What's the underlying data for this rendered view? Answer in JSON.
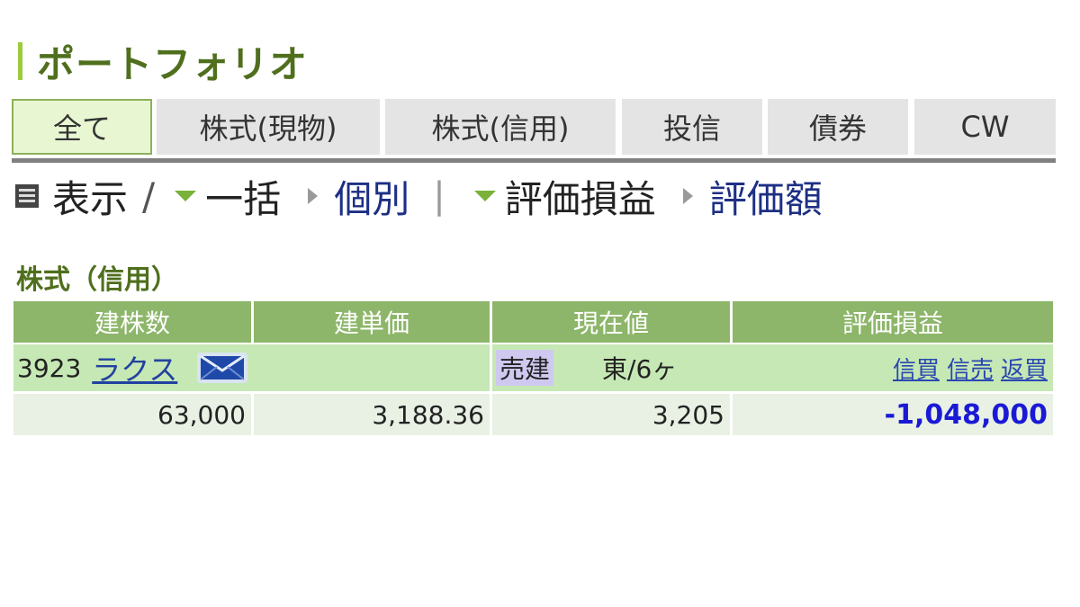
{
  "page": {
    "title": "ポートフォリオ"
  },
  "tabs": [
    {
      "label": "全て",
      "active": true
    },
    {
      "label": "株式(現物)",
      "active": false
    },
    {
      "label": "株式(信用)",
      "active": false
    },
    {
      "label": "投信",
      "active": false
    },
    {
      "label": "債券",
      "active": false
    },
    {
      "label": "CW",
      "active": false
    }
  ],
  "display_bar": {
    "label": "表示",
    "separator": "/",
    "mode_selected": "一括",
    "mode_other": "個別",
    "metric_selected": "評価損益",
    "metric_other": "評価額"
  },
  "section": {
    "title": "株式（信用）",
    "columns": [
      "建株数",
      "建単価",
      "現在値",
      "評価損益"
    ],
    "rows": [
      {
        "code": "3923",
        "name": "ラクス",
        "position_type": "売建",
        "market_term": "東/6ヶ",
        "actions": [
          "信買",
          "信売",
          "返買"
        ],
        "quantity": "63,000",
        "entry_price": "3,188.36",
        "current_price": "3,205",
        "unrealized_pl": "-1,048,000"
      }
    ]
  },
  "icons": {
    "list": "list-icon",
    "mail": "mail-icon"
  },
  "colors": {
    "accent_green": "#4f6f1d",
    "header_green": "#8db66a",
    "row_green": "#c6e8b4",
    "negative": "#1a1ad6"
  }
}
